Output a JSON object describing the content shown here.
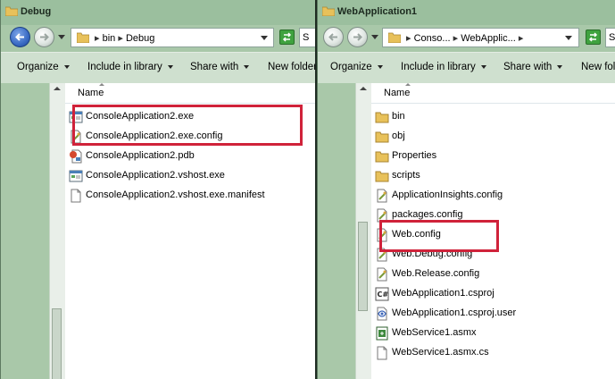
{
  "left_window": {
    "title": "Debug",
    "breadcrumbs": [
      "bin",
      "Debug"
    ],
    "search_text": "S",
    "toolbar": [
      "Organize",
      "Include in library",
      "Share with",
      "New folder"
    ],
    "column_header": "Name",
    "files": [
      {
        "name": "ConsoleApplication2.exe",
        "icon": "exe-icon"
      },
      {
        "name": "ConsoleApplication2.exe.config",
        "icon": "config-file-icon"
      },
      {
        "name": "ConsoleApplication2.pdb",
        "icon": "pdb-icon"
      },
      {
        "name": "ConsoleApplication2.vshost.exe",
        "icon": "exe-icon"
      },
      {
        "name": "ConsoleApplication2.vshost.exe.manifest",
        "icon": "file-icon"
      }
    ]
  },
  "right_window": {
    "title": "WebApplication1",
    "breadcrumbs": [
      "Conso...",
      "WebApplic..."
    ],
    "search_text": "S",
    "toolbar": [
      "Organize",
      "Include in library",
      "Share with",
      "New folder"
    ],
    "column_header": "Name",
    "files": [
      {
        "name": "bin",
        "icon": "folder-icon"
      },
      {
        "name": "obj",
        "icon": "folder-icon"
      },
      {
        "name": "Properties",
        "icon": "folder-icon"
      },
      {
        "name": "scripts",
        "icon": "folder-icon"
      },
      {
        "name": "ApplicationInsights.config",
        "icon": "config-file-icon"
      },
      {
        "name": "packages.config",
        "icon": "config-file-icon"
      },
      {
        "name": "Web.config",
        "icon": "config-file-icon"
      },
      {
        "name": "Web.Debug.config",
        "icon": "config-file-icon"
      },
      {
        "name": "Web.Release.config",
        "icon": "config-file-icon"
      },
      {
        "name": "WebApplication1.csproj",
        "icon": "csharp-project-icon"
      },
      {
        "name": "WebApplication1.csproj.user",
        "icon": "project-user-icon"
      },
      {
        "name": "WebService1.asmx",
        "icon": "asmx-icon"
      },
      {
        "name": "WebService1.asmx.cs",
        "icon": "file-icon"
      }
    ]
  },
  "colors": {
    "highlight": "#d0223a",
    "folder": "#e8c15a"
  }
}
